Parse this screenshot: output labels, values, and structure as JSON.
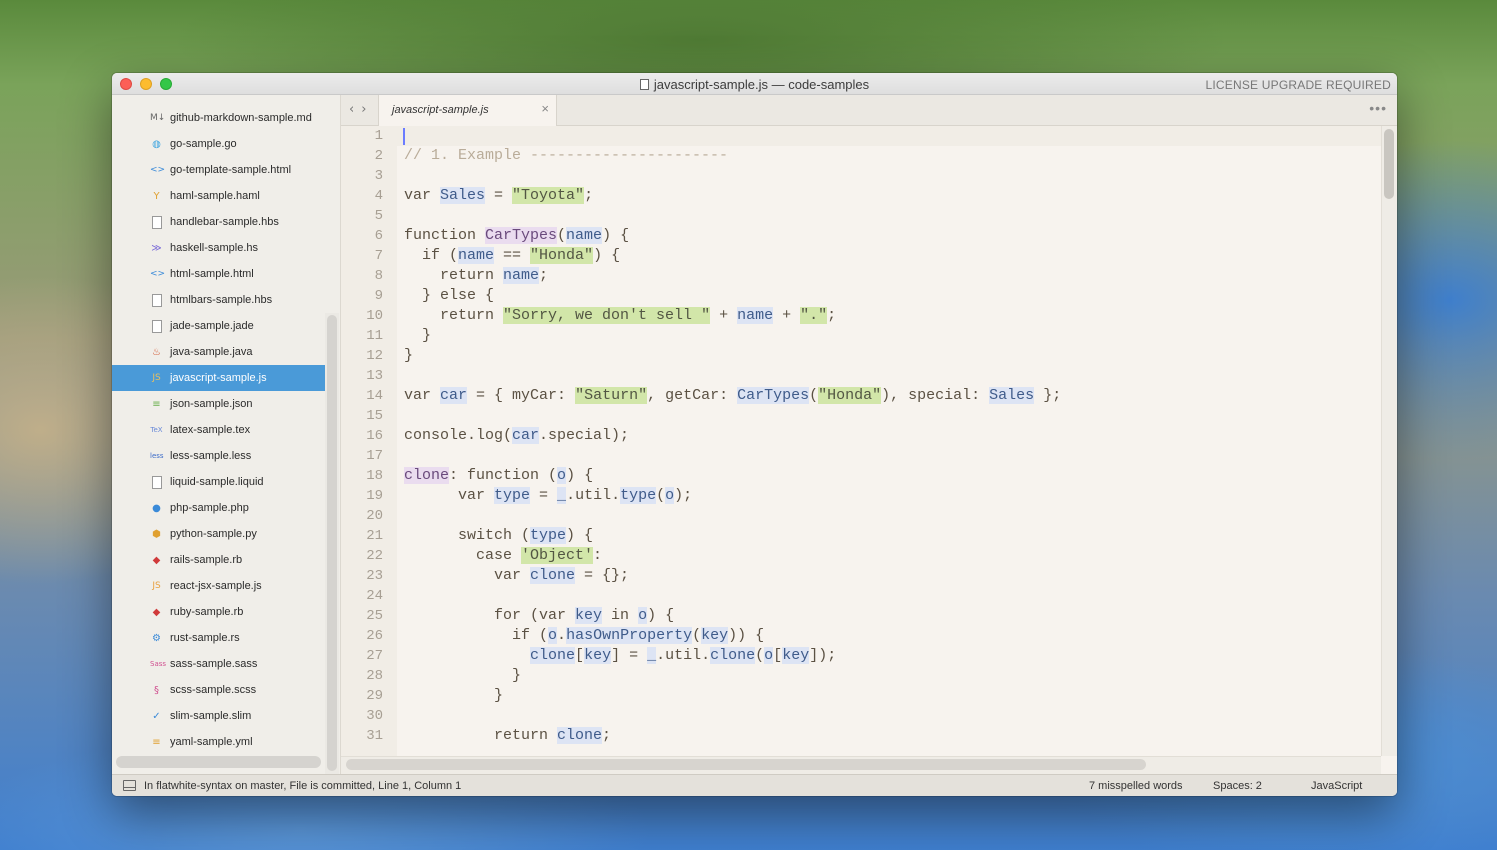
{
  "window": {
    "title": "javascript-sample.js — code-samples",
    "license_notice": "LICENSE UPGRADE REQUIRED"
  },
  "sidebar": {
    "files": [
      {
        "name": "github-markdown-sample.md",
        "icon": "markdown-icon",
        "glyph": "M↓",
        "color": "#666"
      },
      {
        "name": "go-sample.go",
        "icon": "go-icon",
        "glyph": "◍",
        "color": "#3aa3e0"
      },
      {
        "name": "go-template-sample.html",
        "icon": "html-icon",
        "glyph": "<>",
        "color": "#3a8ad8"
      },
      {
        "name": "haml-sample.haml",
        "icon": "haml-icon",
        "glyph": "Y",
        "color": "#e0a030"
      },
      {
        "name": "handlebar-sample.hbs",
        "icon": "file-icon",
        "glyph": "",
        "color": "#999"
      },
      {
        "name": "haskell-sample.hs",
        "icon": "haskell-icon",
        "glyph": "≫",
        "color": "#7a6ad8"
      },
      {
        "name": "html-sample.html",
        "icon": "html-icon",
        "glyph": "<>",
        "color": "#3a8ad8"
      },
      {
        "name": "htmlbars-sample.hbs",
        "icon": "file-icon",
        "glyph": "",
        "color": "#999"
      },
      {
        "name": "jade-sample.jade",
        "icon": "file-icon",
        "glyph": "",
        "color": "#999"
      },
      {
        "name": "java-sample.java",
        "icon": "java-icon",
        "glyph": "♨",
        "color": "#d0502a"
      },
      {
        "name": "javascript-sample.js",
        "icon": "javascript-icon",
        "glyph": "JS",
        "color": "#e8c060",
        "selected": true
      },
      {
        "name": "json-sample.json",
        "icon": "database-icon",
        "glyph": "≡",
        "color": "#6ab04c"
      },
      {
        "name": "latex-sample.tex",
        "icon": "tex-icon",
        "glyph": "TeX",
        "color": "#6a8ad8"
      },
      {
        "name": "less-sample.less",
        "icon": "less-icon",
        "glyph": "less",
        "color": "#3a6ac8"
      },
      {
        "name": "liquid-sample.liquid",
        "icon": "file-icon",
        "glyph": "",
        "color": "#999"
      },
      {
        "name": "php-sample.php",
        "icon": "php-icon",
        "glyph": "●",
        "color": "#3a8ad8"
      },
      {
        "name": "python-sample.py",
        "icon": "python-icon",
        "glyph": "⬢",
        "color": "#e0a030"
      },
      {
        "name": "rails-sample.rb",
        "icon": "ruby-icon",
        "glyph": "◆",
        "color": "#d03a3a"
      },
      {
        "name": "react-jsx-sample.js",
        "icon": "javascript-icon",
        "glyph": "JS",
        "color": "#e8a040"
      },
      {
        "name": "ruby-sample.rb",
        "icon": "ruby-icon",
        "glyph": "◆",
        "color": "#d03a3a"
      },
      {
        "name": "rust-sample.rs",
        "icon": "rust-icon",
        "glyph": "⚙",
        "color": "#3a8ad8"
      },
      {
        "name": "sass-sample.sass",
        "icon": "sass-icon",
        "glyph": "Sass",
        "color": "#d05090"
      },
      {
        "name": "scss-sample.scss",
        "icon": "scss-icon",
        "glyph": "§",
        "color": "#d05090"
      },
      {
        "name": "slim-sample.slim",
        "icon": "slim-icon",
        "glyph": "✓",
        "color": "#3a8ad8"
      },
      {
        "name": "yaml-sample.yml",
        "icon": "database-icon",
        "glyph": "≡",
        "color": "#e0a030"
      }
    ]
  },
  "tabbar": {
    "back_arrow": "‹",
    "forward_arrow": "›",
    "active_tab": "javascript-sample.js",
    "close_glyph": "×",
    "more_glyph": "•••"
  },
  "editor": {
    "lines": [
      [],
      [
        {
          "t": "// 1. Example ----------------------",
          "c": "cm"
        }
      ],
      [],
      [
        {
          "t": "var "
        },
        {
          "t": "Sales",
          "c": "var"
        },
        {
          "t": " = "
        },
        {
          "t": "\"Toyota\"",
          "c": "str"
        },
        {
          "t": ";"
        }
      ],
      [],
      [
        {
          "t": "function "
        },
        {
          "t": "CarTypes",
          "c": "fn"
        },
        {
          "t": "("
        },
        {
          "t": "name",
          "c": "var"
        },
        {
          "t": ") {"
        }
      ],
      [
        {
          "t": "  if ("
        },
        {
          "t": "name",
          "c": "var"
        },
        {
          "t": " == "
        },
        {
          "t": "\"Honda\"",
          "c": "str"
        },
        {
          "t": ") {"
        }
      ],
      [
        {
          "t": "    return "
        },
        {
          "t": "name",
          "c": "var"
        },
        {
          "t": ";"
        }
      ],
      [
        {
          "t": "  } else {"
        }
      ],
      [
        {
          "t": "    return "
        },
        {
          "t": "\"Sorry, we don't sell \"",
          "c": "str"
        },
        {
          "t": " + "
        },
        {
          "t": "name",
          "c": "var"
        },
        {
          "t": " + "
        },
        {
          "t": "\".\"",
          "c": "str"
        },
        {
          "t": ";"
        }
      ],
      [
        {
          "t": "  }"
        }
      ],
      [
        {
          "t": "}"
        }
      ],
      [],
      [
        {
          "t": "var "
        },
        {
          "t": "car",
          "c": "var"
        },
        {
          "t": " = { myCar: "
        },
        {
          "t": "\"Saturn\"",
          "c": "str"
        },
        {
          "t": ", getCar: "
        },
        {
          "t": "CarTypes",
          "c": "var"
        },
        {
          "t": "("
        },
        {
          "t": "\"Honda\"",
          "c": "str"
        },
        {
          "t": "), special: "
        },
        {
          "t": "Sales",
          "c": "var"
        },
        {
          "t": " };"
        }
      ],
      [],
      [
        {
          "t": "console.log("
        },
        {
          "t": "car",
          "c": "var"
        },
        {
          "t": ".special);"
        }
      ],
      [],
      [
        {
          "t": "clone",
          "c": "fn"
        },
        {
          "t": ": function ("
        },
        {
          "t": "o",
          "c": "var"
        },
        {
          "t": ") {"
        }
      ],
      [
        {
          "t": "      var "
        },
        {
          "t": "type",
          "c": "var"
        },
        {
          "t": " = "
        },
        {
          "t": "_",
          "c": "var"
        },
        {
          "t": ".util."
        },
        {
          "t": "type",
          "c": "var"
        },
        {
          "t": "("
        },
        {
          "t": "o",
          "c": "var"
        },
        {
          "t": ");"
        }
      ],
      [],
      [
        {
          "t": "      switch ("
        },
        {
          "t": "type",
          "c": "var"
        },
        {
          "t": ") {"
        }
      ],
      [
        {
          "t": "        case "
        },
        {
          "t": "'Object'",
          "c": "str"
        },
        {
          "t": ":"
        }
      ],
      [
        {
          "t": "          var "
        },
        {
          "t": "clone",
          "c": "var"
        },
        {
          "t": " = {};"
        }
      ],
      [],
      [
        {
          "t": "          for (var "
        },
        {
          "t": "key",
          "c": "var"
        },
        {
          "t": " in "
        },
        {
          "t": "o",
          "c": "var"
        },
        {
          "t": ") {"
        }
      ],
      [
        {
          "t": "            if ("
        },
        {
          "t": "o",
          "c": "var"
        },
        {
          "t": "."
        },
        {
          "t": "hasOwnProperty",
          "c": "var"
        },
        {
          "t": "("
        },
        {
          "t": "key",
          "c": "var"
        },
        {
          "t": ")) {"
        }
      ],
      [
        {
          "t": "              "
        },
        {
          "t": "clone",
          "c": "var"
        },
        {
          "t": "["
        },
        {
          "t": "key",
          "c": "var"
        },
        {
          "t": "] = "
        },
        {
          "t": "_",
          "c": "var"
        },
        {
          "t": ".util."
        },
        {
          "t": "clone",
          "c": "var"
        },
        {
          "t": "("
        },
        {
          "t": "o",
          "c": "var"
        },
        {
          "t": "["
        },
        {
          "t": "key",
          "c": "var"
        },
        {
          "t": "]);"
        }
      ],
      [
        {
          "t": "            }"
        }
      ],
      [
        {
          "t": "          }"
        }
      ],
      [],
      [
        {
          "t": "          return "
        },
        {
          "t": "clone",
          "c": "var"
        },
        {
          "t": ";"
        }
      ]
    ]
  },
  "statusbar": {
    "git_info": "In flatwhite-syntax on master, File is committed, Line 1, Column 1",
    "misspelled": "7 misspelled words",
    "spaces": "Spaces: 2",
    "language": "JavaScript"
  }
}
